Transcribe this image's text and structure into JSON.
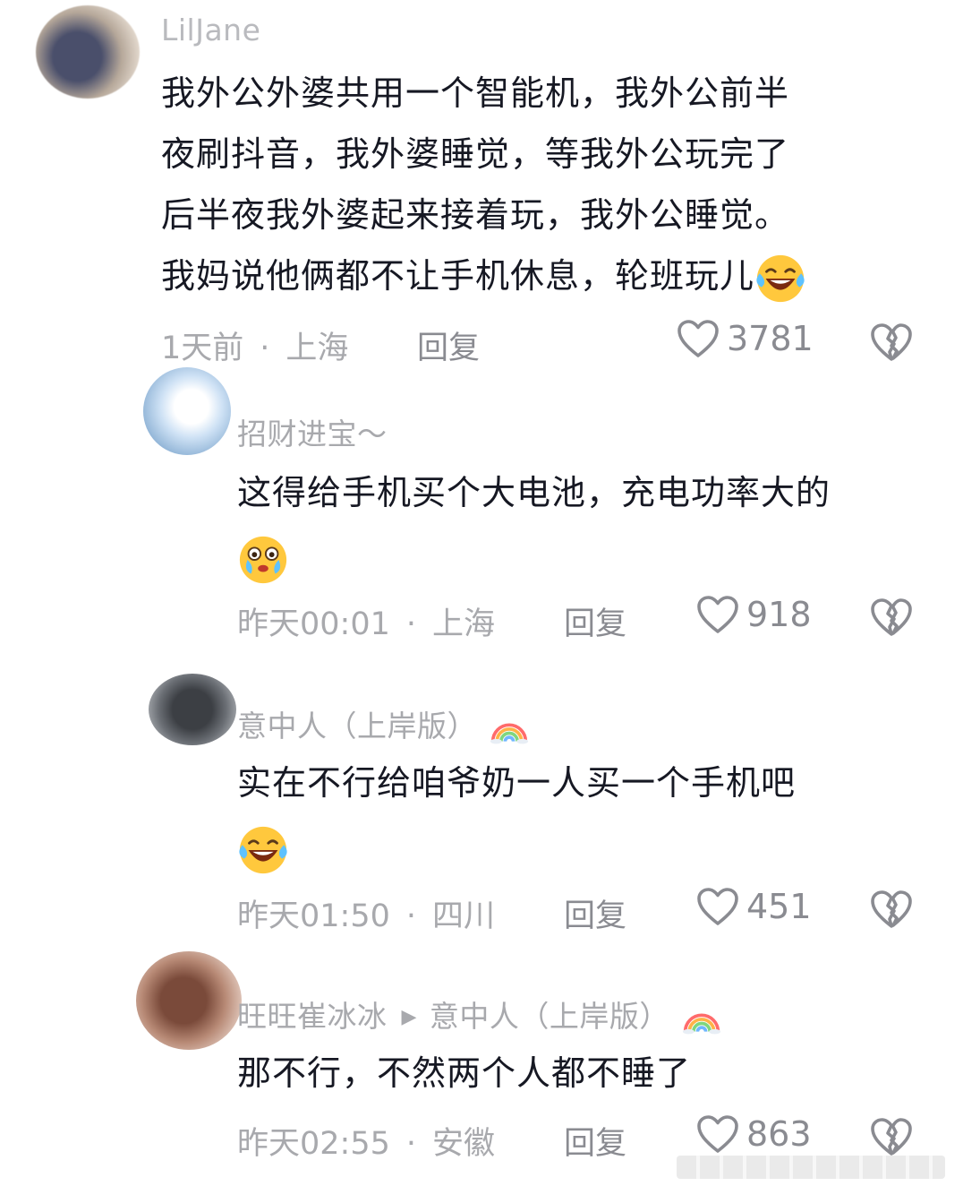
{
  "comments": [
    {
      "username": "LilJane",
      "lines": [
        "我外公外婆共用一个智能机，我外公前半",
        "夜刷抖音，我外婆睡觉，等我外公玩完了",
        "后半夜我外婆起来接着玩，我外公睡觉。",
        "我妈说他俩都不让手机休息，轮班玩儿"
      ],
      "time": "1天前",
      "location": "上海",
      "reply_label": "回复",
      "likes": "3781",
      "emoji": "laugh-cry-emoji"
    },
    {
      "username": "招财进宝～",
      "lines": [
        "这得给手机买个大电池，充电功率大的"
      ],
      "time": "昨天00:01",
      "location": "上海",
      "reply_label": "回复",
      "likes": "918",
      "emoji": "teary-eyed-emoji"
    },
    {
      "username": "意中人（上岸版）",
      "lines": [
        "实在不行给咱爷奶一人买一个手机吧"
      ],
      "time": "昨天01:50",
      "location": "四川",
      "reply_label": "回复",
      "likes": "451",
      "emoji": "laugh-cry-emoji"
    },
    {
      "username": "旺旺崔冰冰",
      "reply_to": "意中人（上岸版）",
      "lines": [
        "那不行，不然两个人都不睡了"
      ],
      "time": "昨天02:55",
      "location": "安徽",
      "reply_label": "回复",
      "likes": "863"
    }
  ],
  "colors": {
    "text": "#161823",
    "meta": "#a8a9ad",
    "action": "#8a8b91",
    "background": "#ffffff"
  }
}
